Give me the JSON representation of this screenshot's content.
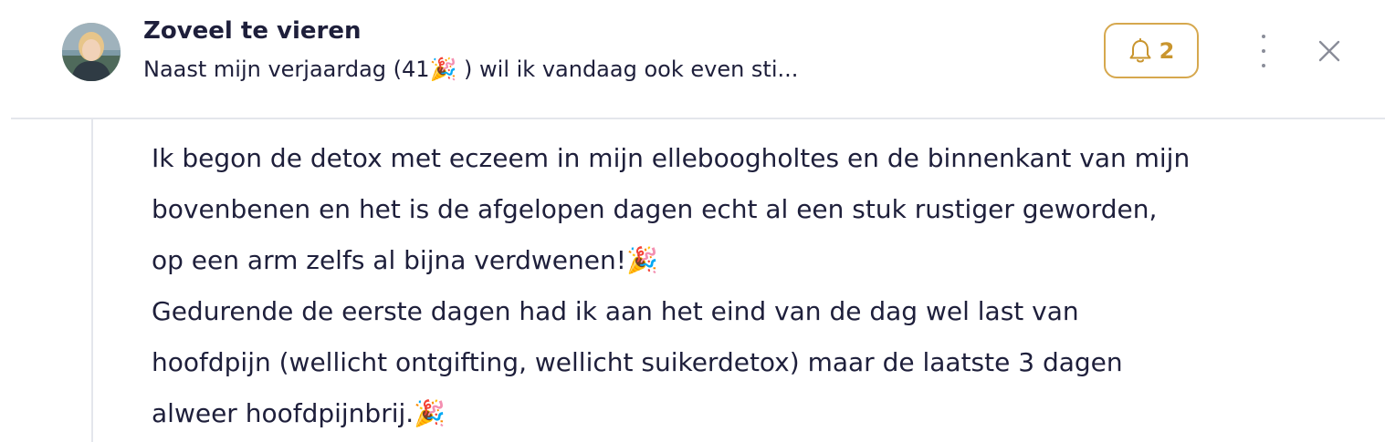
{
  "header": {
    "title": "Zoveel te vieren",
    "preview": "Naast mijn verjaardag (41🎉 ) wil ik vandaag ook even sti...",
    "bell_count": "2",
    "icons": {
      "avatar": "avatar-photo",
      "bell": "bell-icon",
      "more": "vertical-dots-icon",
      "close": "close-icon"
    }
  },
  "message": {
    "lines": [
      "Ik begon de detox met eczeem in mijn elleboogholtes en de binnenkant van mijn",
      "bovenbenen en het is de afgelopen dagen echt al een stuk rustiger geworden,",
      "op een arm zelfs al bijna verdwenen!🎉",
      "Gedurende de eerste dagen had ik aan het eind van de dag wel last van",
      "hoofdpijn (wellicht ontgifting, wellicht suikerdetox) maar de laatste 3 dagen",
      "alweer hoofdpijnbrij.🎉"
    ]
  },
  "colors": {
    "accent_gold": "#c9952e",
    "text": "#1e1f3b",
    "divider": "#e4e6ec",
    "icon_gray": "#8a8d99"
  }
}
